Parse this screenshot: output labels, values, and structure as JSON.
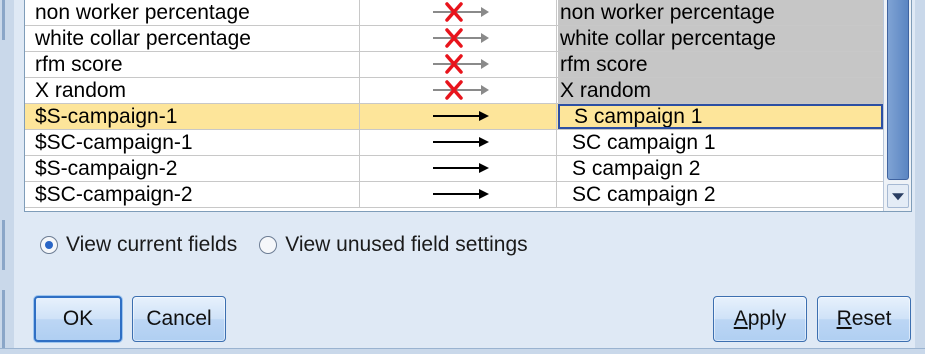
{
  "fields_table": {
    "rows": [
      {
        "field": "non worker percentage",
        "status": "filtered",
        "new_name": "non worker percentage",
        "state": "grey"
      },
      {
        "field": "white collar percentage",
        "status": "filtered",
        "new_name": "white collar percentage",
        "state": "grey"
      },
      {
        "field": "rfm score",
        "status": "filtered",
        "new_name": "rfm score",
        "state": "grey"
      },
      {
        "field": "X random",
        "status": "filtered",
        "new_name": "X random",
        "state": "grey"
      },
      {
        "field": "$S-campaign-1",
        "status": "pass",
        "new_name": "S campaign 1",
        "state": "selected"
      },
      {
        "field": "$SC-campaign-1",
        "status": "pass",
        "new_name": "SC campaign 1",
        "state": "normal"
      },
      {
        "field": "$S-campaign-2",
        "status": "pass",
        "new_name": "S campaign 2",
        "state": "normal"
      },
      {
        "field": "$SC-campaign-2",
        "status": "pass",
        "new_name": "SC campaign 2",
        "state": "normal"
      }
    ]
  },
  "view_options": {
    "current_label": "View current fields",
    "unused_label": "View unused field settings",
    "selected": "current"
  },
  "buttons": {
    "ok": "OK",
    "cancel": "Cancel",
    "apply_mnemonic": "A",
    "apply_rest": "pply",
    "reset_mnemonic": "R",
    "reset_rest": "eset"
  },
  "colors": {
    "selected_row": "#fde59a",
    "filtered_cell": "#c6c6c6",
    "filter_x": "#e8141c"
  }
}
